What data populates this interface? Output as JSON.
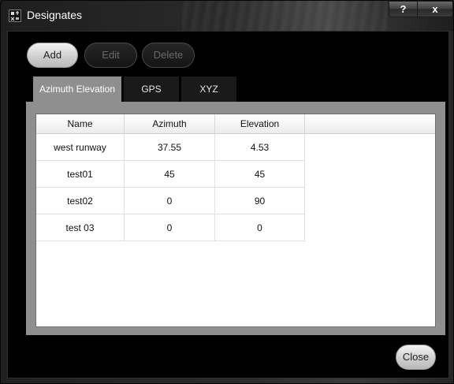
{
  "window": {
    "title": "Designates",
    "help_label": "?",
    "close_label": "x"
  },
  "toolbar": {
    "add_label": "Add",
    "edit_label": "Edit",
    "delete_label": "Delete"
  },
  "tabs": [
    {
      "label": "Azimuth  Elevation",
      "active": true
    },
    {
      "label": "GPS",
      "active": false
    },
    {
      "label": "XYZ",
      "active": false
    }
  ],
  "table": {
    "columns": [
      "Name",
      "Azimuth",
      "Elevation"
    ],
    "rows": [
      [
        "west runway",
        "37.55",
        "4.53"
      ],
      [
        "test01",
        "45",
        "45"
      ],
      [
        "test02",
        "0",
        "90"
      ],
      [
        "test 03",
        "0",
        "0"
      ]
    ]
  },
  "footer": {
    "close_label": "Close"
  },
  "colors": {
    "tab_active_bg": "#8f8f8f",
    "tab_inactive_bg": "#1a1a1a",
    "client_bg": "#000000"
  }
}
